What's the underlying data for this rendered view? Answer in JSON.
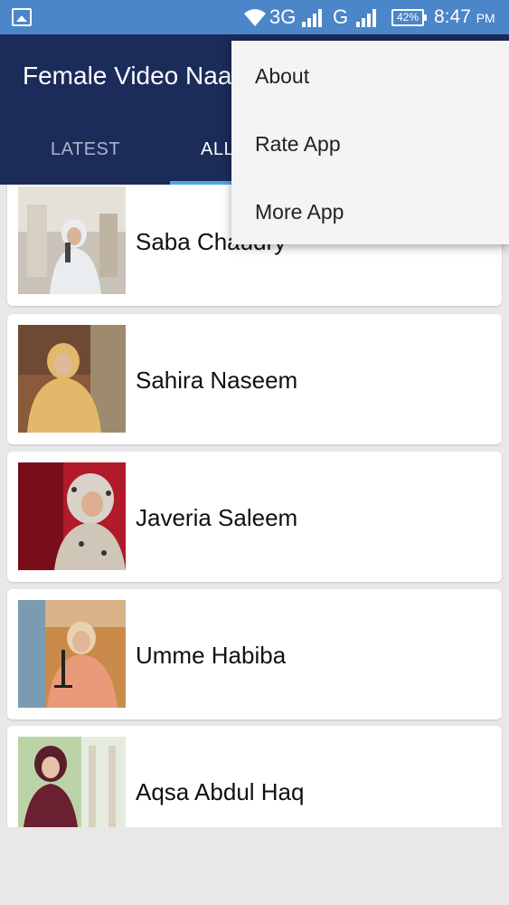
{
  "status_bar": {
    "network_1": "3G",
    "network_2": "G",
    "battery": "42%",
    "time": "8:47",
    "ampm": "PM",
    "icons": [
      "gallery-icon",
      "wifi-icon",
      "signal-icon",
      "signal-icon",
      "battery-icon"
    ]
  },
  "app_bar": {
    "title": "Female Video Naat",
    "tabs": [
      {
        "label": "LATEST"
      },
      {
        "label": "ALL"
      }
    ],
    "colors": {
      "background": "#1b2b5a",
      "indicator": "#4fa3e6"
    }
  },
  "menu": {
    "items": [
      {
        "label": "About"
      },
      {
        "label": "Rate App"
      },
      {
        "label": "More App"
      }
    ]
  },
  "list": {
    "items": [
      {
        "name": "Saba Chaudry"
      },
      {
        "name": "Sahira Naseem"
      },
      {
        "name": "Javeria Saleem"
      },
      {
        "name": "Umme Habiba"
      },
      {
        "name": "Aqsa Abdul Haq"
      }
    ]
  }
}
